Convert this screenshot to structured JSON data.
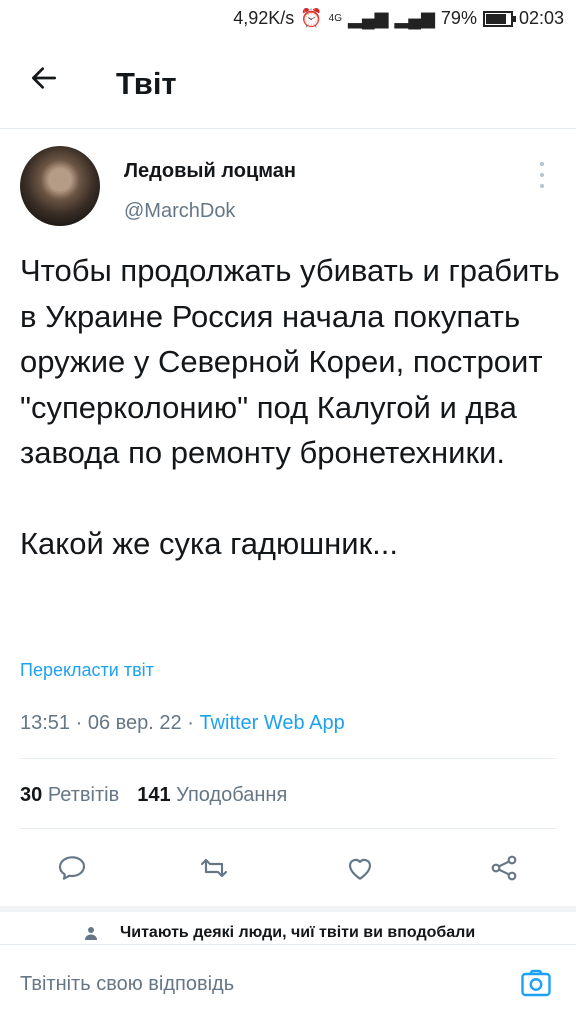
{
  "status_bar": {
    "speed": "4,92K/s",
    "network": "4G",
    "battery": "79%",
    "time": "02:03"
  },
  "header": {
    "title": "Твіт"
  },
  "tweet": {
    "author_name": "Ледовый лоцман",
    "author_handle": "@MarchDok",
    "text": "Чтобы продолжать убивать и грабить в Украине Россия начала покупать оружие у Северной Кореи, построит \"суперколонию\" под Калугой и два завода по ремонту бронетехники.\n\nКакой же сука гадюшник...",
    "translate_label": "Перекласти твіт",
    "time": "13:51",
    "date": "06 вер. 22",
    "app": "Twitter Web App",
    "retweets_count": "30",
    "retweets_label": "Ретвітів",
    "likes_count": "141",
    "likes_label": "Уподобання"
  },
  "notice": "Читають деякі люди, чиї твіти ви вподобали",
  "reply": {
    "placeholder": "Твітніть свою відповідь"
  },
  "colors": {
    "accent": "#1da1f2",
    "secondary_text": "#657786",
    "divider": "#e6ecf0"
  }
}
